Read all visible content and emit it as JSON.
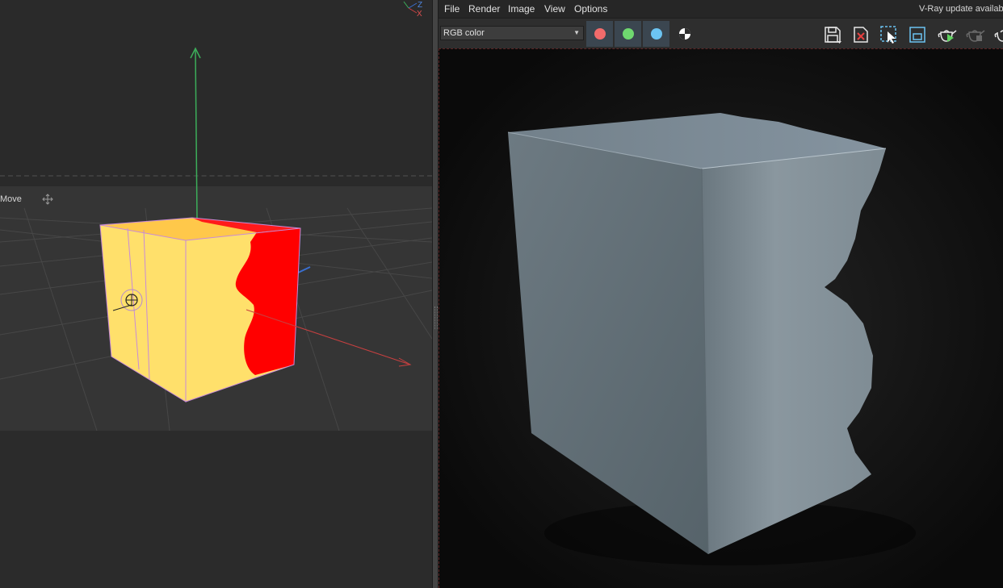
{
  "viewport": {
    "mode_label": "Move",
    "axes": {
      "z": "Z",
      "x": "X"
    },
    "colors": {
      "cube_front": "#ffe06b",
      "cube_side": "#ff0000",
      "axis_x": "#c84040",
      "axis_y": "#3cae5a",
      "axis_z": "#3a6fd0"
    }
  },
  "vfb": {
    "menu": [
      "File",
      "Render",
      "Image",
      "View",
      "Options"
    ],
    "update_notice": "V-Ray update availabl",
    "channel_select": {
      "value": "RGB color"
    },
    "channel_buttons": [
      {
        "name": "red-channel-button",
        "color": "#f26b6b"
      },
      {
        "name": "green-channel-button",
        "color": "#6fd86f"
      },
      {
        "name": "blue-channel-button",
        "color": "#6cc4f2"
      }
    ],
    "icons": [
      "monochrome-icon",
      "save-icon",
      "clear-image-icon",
      "region-select-icon",
      "render-region-icon",
      "start-render-icon",
      "stop-render-icon",
      "teapot-icon"
    ]
  }
}
